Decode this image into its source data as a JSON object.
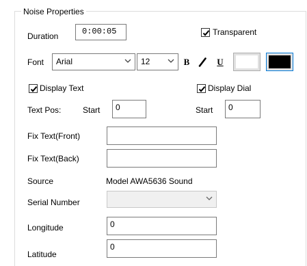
{
  "group": {
    "title": "Noise Properties"
  },
  "duration": {
    "label": "Duration",
    "value": "0:00:05"
  },
  "transparent": {
    "label": "Transparent",
    "checked": true
  },
  "font": {
    "label": "Font",
    "family": "Arial",
    "size": "12",
    "bold_label": "B",
    "underline_label": "U"
  },
  "colors": {
    "foreground": "#ffffff",
    "background": "#000000"
  },
  "display_text": {
    "label": "Display Text",
    "checked": true
  },
  "display_dial": {
    "label": "Display Dial",
    "checked": true
  },
  "text_pos": {
    "label": "Text Pos:",
    "start_label": "Start",
    "start_value": "0",
    "dial_start_label": "Start",
    "dial_start_value": "0"
  },
  "fix_text_front": {
    "label": "Fix Text(Front)",
    "value": ""
  },
  "fix_text_back": {
    "label": "Fix Text(Back)",
    "value": ""
  },
  "source": {
    "label": "Source",
    "value": "Model AWA5636 Sound"
  },
  "serial_number": {
    "label": "Serial Number",
    "value": ""
  },
  "longitude": {
    "label": "Longitude",
    "value": "0"
  },
  "latitude": {
    "label": "Latitude",
    "value": "0"
  }
}
